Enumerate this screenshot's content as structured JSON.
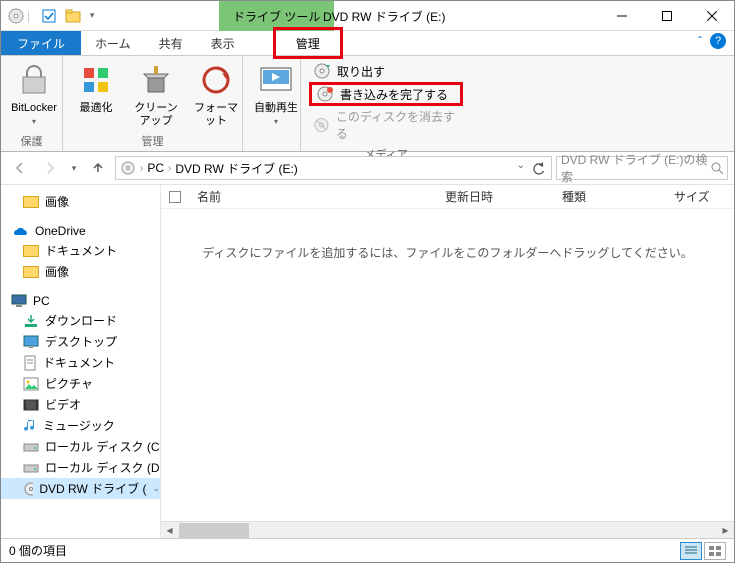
{
  "titlebar": {
    "drive_tools_label": "ドライブ ツール",
    "title": "DVD RW ドライブ (E:)"
  },
  "tabs": {
    "file": "ファイル",
    "home": "ホーム",
    "share": "共有",
    "view": "表示",
    "manage": "管理"
  },
  "ribbon": {
    "bitlocker": "BitLocker",
    "optimize": "最適化",
    "cleanup": "クリーンアップ",
    "format": "フォーマット",
    "autoplay": "自動再生",
    "group_protect": "保護",
    "group_manage": "管理",
    "group_media": "メディア",
    "eject": "取り出す",
    "finish_burn": "書き込みを完了する",
    "erase_disc": "このディスクを消去する"
  },
  "breadcrumb": {
    "pc": "PC",
    "drive": "DVD RW ドライブ (E:)"
  },
  "search": {
    "placeholder": "DVD RW ドライブ (E:)の検索"
  },
  "tree": {
    "pictures": "画像",
    "onedrive": "OneDrive",
    "documents": "ドキュメント",
    "pictures2": "画像",
    "pc": "PC",
    "downloads": "ダウンロード",
    "desktop": "デスクトップ",
    "documents2": "ドキュメント",
    "pictures3": "ピクチャ",
    "videos": "ビデオ",
    "music": "ミュージック",
    "localdisk_c": "ローカル ディスク (C",
    "localdisk_d": "ローカル ディスク (D",
    "dvd": "DVD RW ドライブ ("
  },
  "columns": {
    "name": "名前",
    "date": "更新日時",
    "type": "種類",
    "size": "サイズ"
  },
  "empty_message": "ディスクにファイルを追加するには、ファイルをこのフォルダーへドラッグしてください。",
  "status": {
    "items": "0 個の項目"
  }
}
